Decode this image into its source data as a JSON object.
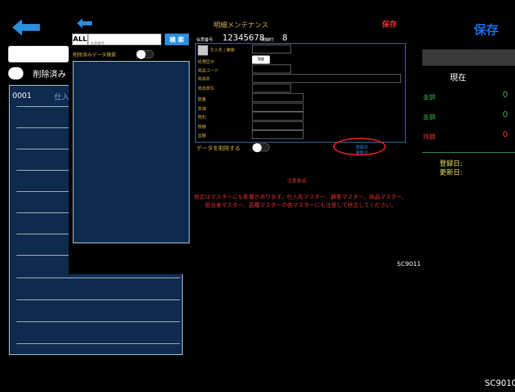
{
  "back_screen": {
    "save_label": "保存",
    "deleted_toggle_label": "削除済み",
    "list_first_row": {
      "code": "0001",
      "name": "仕入"
    },
    "summary": {
      "header": "現在",
      "rows": [
        {
          "label": "金額",
          "value": "0",
          "color": "#2fa84a"
        },
        {
          "label": "金額",
          "value": "0",
          "color": "#2fa84a"
        },
        {
          "label": "残額",
          "value": "0",
          "color": "#e03030"
        }
      ],
      "registered_label": "登録日:",
      "updated_label": "更新日:"
    },
    "screen_code": "SC9010"
  },
  "front_screen": {
    "title": "明細メンテナンス",
    "save_label": "保存",
    "all_button": "ALL",
    "search_placeholder": "伝票番号",
    "search_button": "検 索",
    "deleted_search_label": "削除済みデータ検索",
    "slip_number_label": "伝票番号",
    "slip_number": "12345678",
    "line_number_label": "明細行",
    "line_number": "8",
    "supplier_customer_label": "仕入先 / 顧客",
    "fields": [
      "処理区分",
      "商品コード",
      "商品名",
      "商品単位",
      "数量",
      "単価",
      "税別",
      "税額",
      "金額"
    ],
    "process_button": "現金",
    "registered_label": "登録日:",
    "updated_label": "更新日:",
    "delete_data_label": "データを削除する",
    "notes_title": "注意事項",
    "notes_text": "修正はマスターにも影響があります。仕入先マスター、顧客マスター、商品マスター、担当者マスター、品種マスターの各マスターにも注意して修正してください。",
    "screen_code": "SC9011"
  },
  "colors": {
    "accent_blue": "#2b8fe0",
    "label_gold": "#d6b44a",
    "alert_red": "#e03030",
    "positive_green": "#2fa84a",
    "list_navy": "#0e2a4e"
  }
}
